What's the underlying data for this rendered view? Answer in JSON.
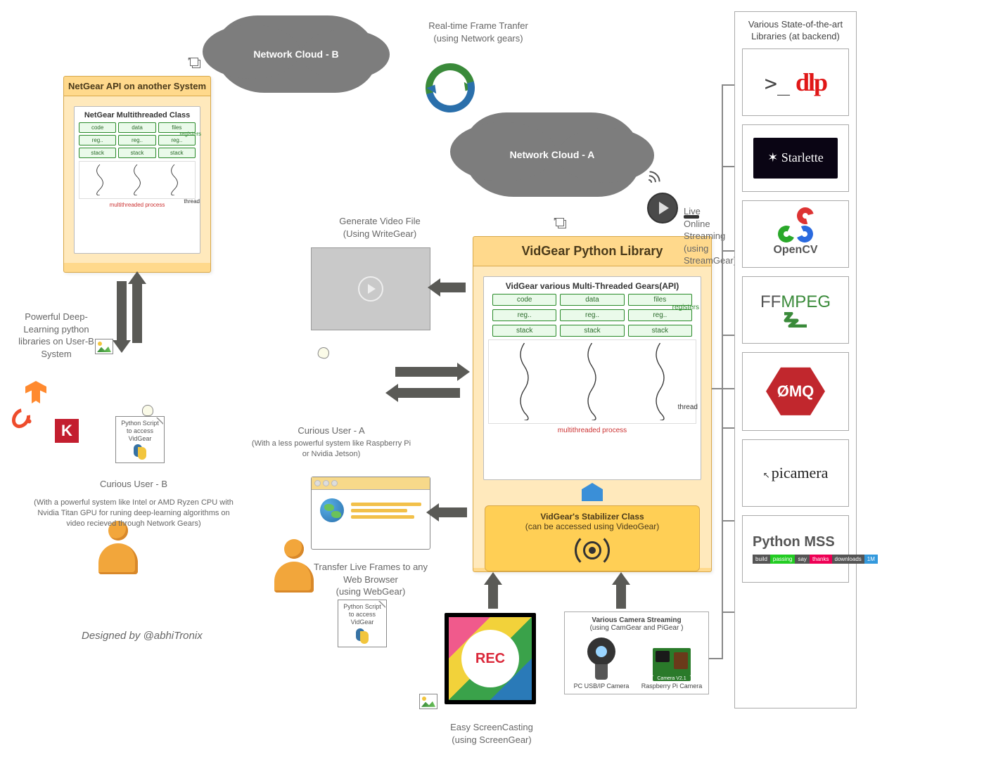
{
  "clouds": {
    "b": "Network Cloud - B",
    "a": "Network Cloud - A"
  },
  "frame_transfer": {
    "title": "Real-time Frame Tranfer",
    "sub": "(using Network gears)"
  },
  "netgear_panel": {
    "title": "NetGear API on another System",
    "card_title": "NetGear Multithreaded Class",
    "cells": [
      "code",
      "data",
      "files",
      "reg..",
      "reg..",
      "reg..",
      "stack",
      "stack",
      "stack"
    ],
    "annot_reg": "registers",
    "annot_thread": "thread",
    "foot": "multithreaded process"
  },
  "user_b": {
    "dl_note": "Powerful Deep-Learning python libraries on User-B System",
    "script": "Python Script to access VidGear",
    "name": "Curious User - B",
    "desc": "(With a powerful system like Intel or AMD Ryzen CPU with Nvidia Titan GPU for runing deep-learning algorithms on video recieved through Network Gears)"
  },
  "user_a": {
    "script": "Python Script to access VidGear",
    "name": "Curious User - A",
    "desc": "(With a less powerful system like Raspberry Pi or Nvidia Jetson)"
  },
  "vidgear_panel": {
    "title": "VidGear Python Library",
    "card_title": "VidGear various Multi-Threaded Gears(API)",
    "cells": [
      "code",
      "data",
      "files",
      "reg..",
      "reg..",
      "reg..",
      "stack",
      "stack",
      "stack"
    ],
    "annot_reg": "registers",
    "annot_thread": "thread",
    "foot": "multithreaded process",
    "stab_title": "VidGear's Stabilizer Class",
    "stab_sub": "(can be accessed using VideoGear)"
  },
  "writegear": {
    "title": "Generate Video File",
    "sub": "(Using WriteGear)"
  },
  "webgear": {
    "title": "Transfer Live Frames to any Web Browser",
    "sub": "(using WebGear)"
  },
  "streamgear": {
    "title": "Live Online Streaming",
    "sub": "(using StreamGear)"
  },
  "screengear": {
    "title": "Easy ScreenCasting",
    "sub": "(using ScreenGear)",
    "rec": "REC"
  },
  "cameras": {
    "title_a": "Various Camera Streaming",
    "title_b": "(using  CamGear and PiGear   )",
    "pc": "PC USB/IP Camera",
    "rpi_board": "Camera V2.1",
    "rpi": "Raspberry Pi Camera"
  },
  "backends": {
    "header": "Various State-of-the-art Libraries (at backend)",
    "dlp_prompt": ">_",
    "dlp": "dlp",
    "starlette": "Starlette",
    "opencv": "OpenCV",
    "ffmpeg_a": "FF",
    "ffmpeg_b": "MPEG",
    "zmq": "ØMQ",
    "picamera": "picamera",
    "mss": "Python MSS",
    "badges": [
      "build",
      "passing",
      "say",
      "thanks",
      "downloads",
      "1M"
    ]
  },
  "credit": "Designed by @abhiTronix"
}
